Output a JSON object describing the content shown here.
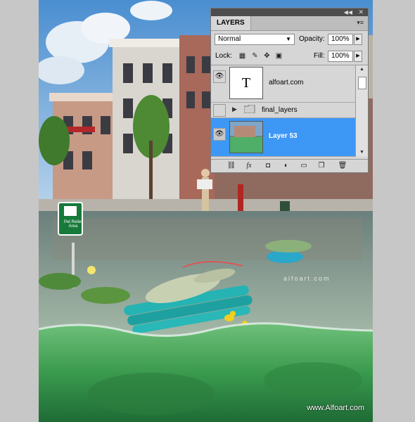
{
  "artwork": {
    "watermark": "www.Alfoart.com",
    "water_watermark": "alfoart.com",
    "sign_text": "Pet Relief Area"
  },
  "panel": {
    "tab_label": "LAYERS",
    "blend_mode": "Normal",
    "opacity_label": "Opacity:",
    "opacity_value": "100%",
    "lock_label": "Lock:",
    "fill_label": "Fill:",
    "fill_value": "100%",
    "layers": [
      {
        "name": "alfoart.com",
        "thumb_text": "T",
        "visible": true,
        "selected": false
      },
      {
        "name": "final_layers",
        "visible": false,
        "selected": false
      },
      {
        "name": "Layer 53",
        "visible": true,
        "selected": true
      }
    ],
    "icons": [
      "link-icon",
      "fx-icon",
      "mask-icon",
      "adjustment-icon",
      "folder-icon",
      "new-layer-icon",
      "trash-icon"
    ]
  },
  "colors": {
    "selected_row": "#3d97f5",
    "panel_bg": "#d6d6d6",
    "titlebar": "#4d4d4d"
  }
}
